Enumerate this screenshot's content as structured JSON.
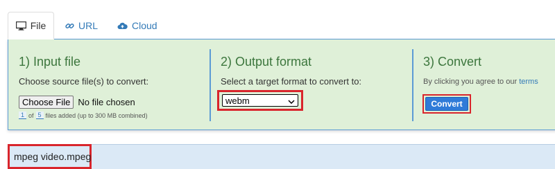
{
  "tabs": [
    {
      "label": "File",
      "icon": "monitor-icon"
    },
    {
      "label": "URL",
      "icon": "link-icon"
    },
    {
      "label": "Cloud",
      "icon": "cloud-upload-icon"
    }
  ],
  "input_section": {
    "title": "1) Input file",
    "description": "Choose source file(s) to convert:",
    "choose_button": "Choose File",
    "no_file_text": "No file chosen",
    "files_added": "1",
    "files_max": "5",
    "of_text": "of",
    "limit_text": "files added (up to 300 MB combined)"
  },
  "output_section": {
    "title": "2) Output format",
    "description": "Select a target format to convert to:",
    "selected_format": "webm"
  },
  "convert_section": {
    "title": "3) Convert",
    "agree_text": "By clicking you agree to our",
    "terms_link": "terms",
    "convert_button": "Convert"
  },
  "file_list": {
    "file_name": "mpeg video.mpeg"
  },
  "colors": {
    "panel_bg": "#dff0d8",
    "title_green": "#3c763d",
    "accent_blue": "#337ab7",
    "highlight_red": "#d9252c",
    "convert_blue": "#2f7bd8",
    "strip_bg": "#dbe9f6"
  }
}
